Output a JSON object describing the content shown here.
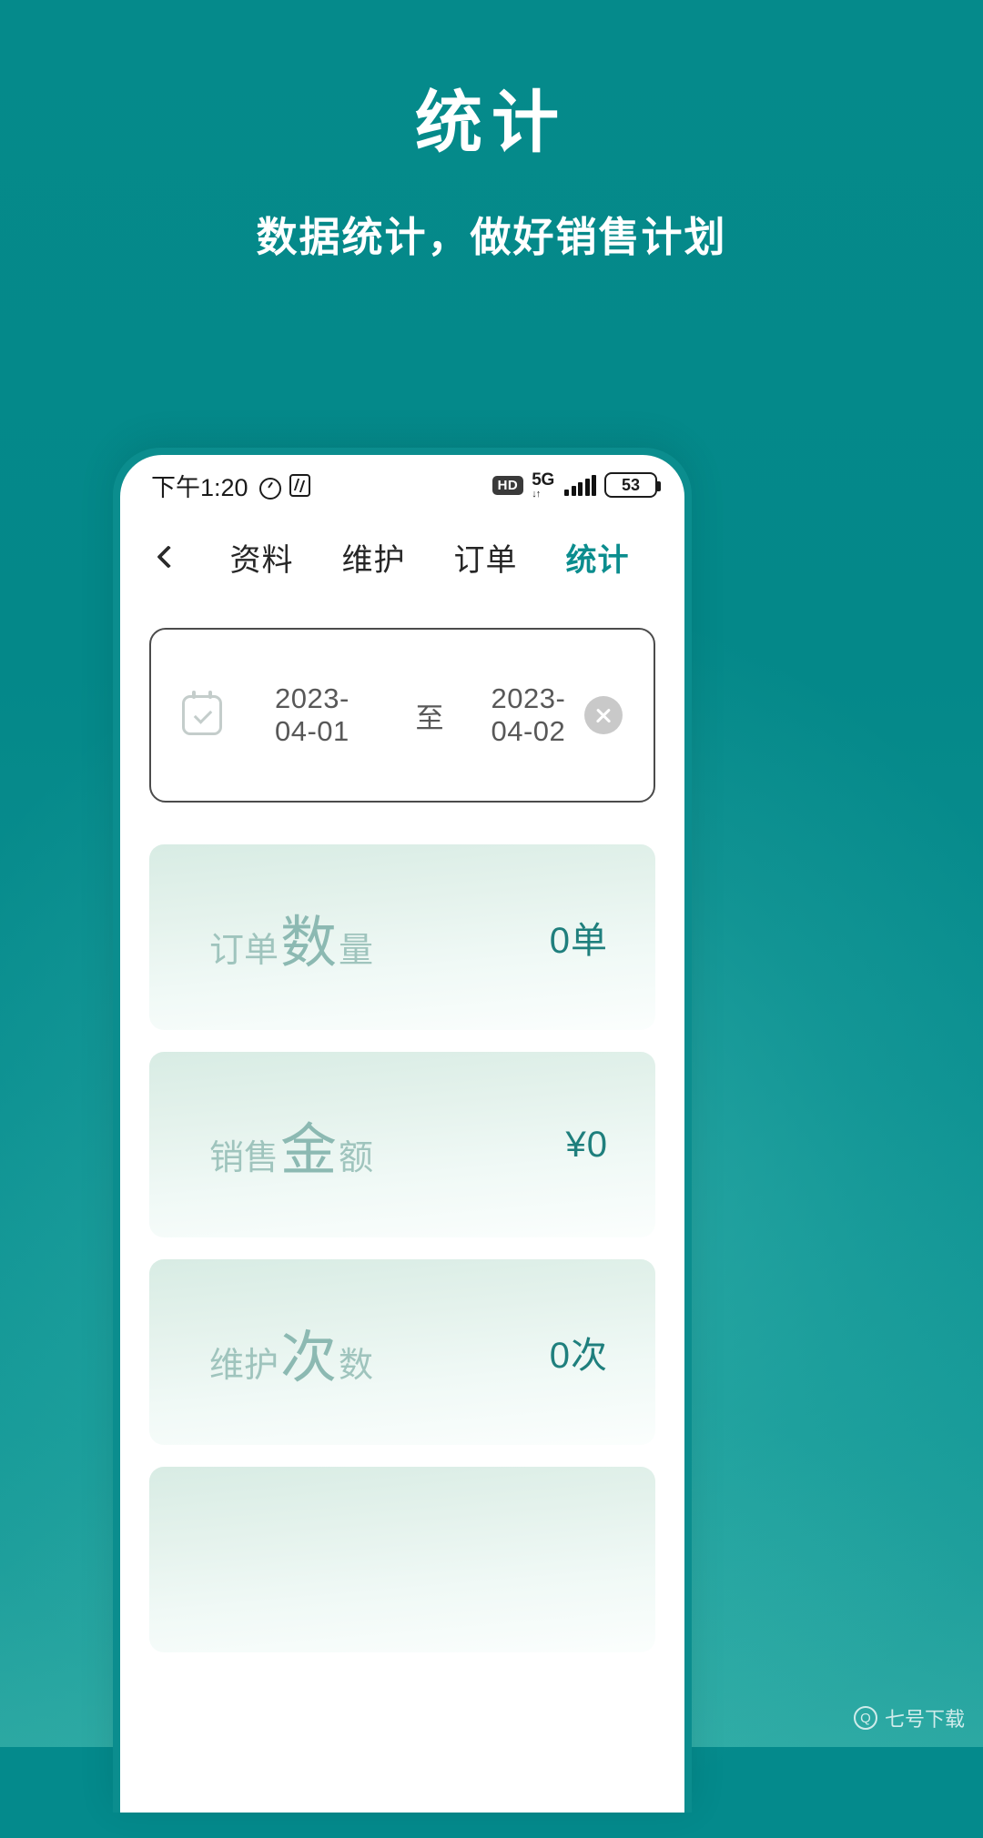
{
  "promo": {
    "title": "统计",
    "subtitle": "数据统计，做好销售计划",
    "background_color": "#048a8c",
    "accent_color": "#0b8d8e"
  },
  "status_bar": {
    "time": "下午1:20",
    "alarm_icon": "alarm-icon",
    "nfc_icon": "nfc-icon",
    "hd_badge": "HD",
    "network_label": "5G",
    "network_sub": "↓↑",
    "battery_percent": "53"
  },
  "nav": {
    "back_icon": "chevron-left-icon",
    "tabs": [
      {
        "label": "资料",
        "active": false
      },
      {
        "label": "维护",
        "active": false
      },
      {
        "label": "订单",
        "active": false
      },
      {
        "label": "统计",
        "active": true
      }
    ]
  },
  "date_range": {
    "calendar_icon": "calendar-check-icon",
    "start": "2023-04-01",
    "separator": "至",
    "end": "2023-04-02",
    "clear_icon": "close-circle-icon"
  },
  "stats": [
    {
      "label_prefix": "订单",
      "label_big": "数",
      "label_suffix": "量",
      "value": "0单"
    },
    {
      "label_prefix": "销售",
      "label_big": "金",
      "label_suffix": "额",
      "value": "¥0"
    },
    {
      "label_prefix": "维护",
      "label_big": "次",
      "label_suffix": "数",
      "value": "0次"
    },
    {
      "label_prefix": "",
      "label_big": "",
      "label_suffix": "",
      "value": ""
    }
  ],
  "watermark": {
    "logo": "Q",
    "text": "七号下载"
  }
}
